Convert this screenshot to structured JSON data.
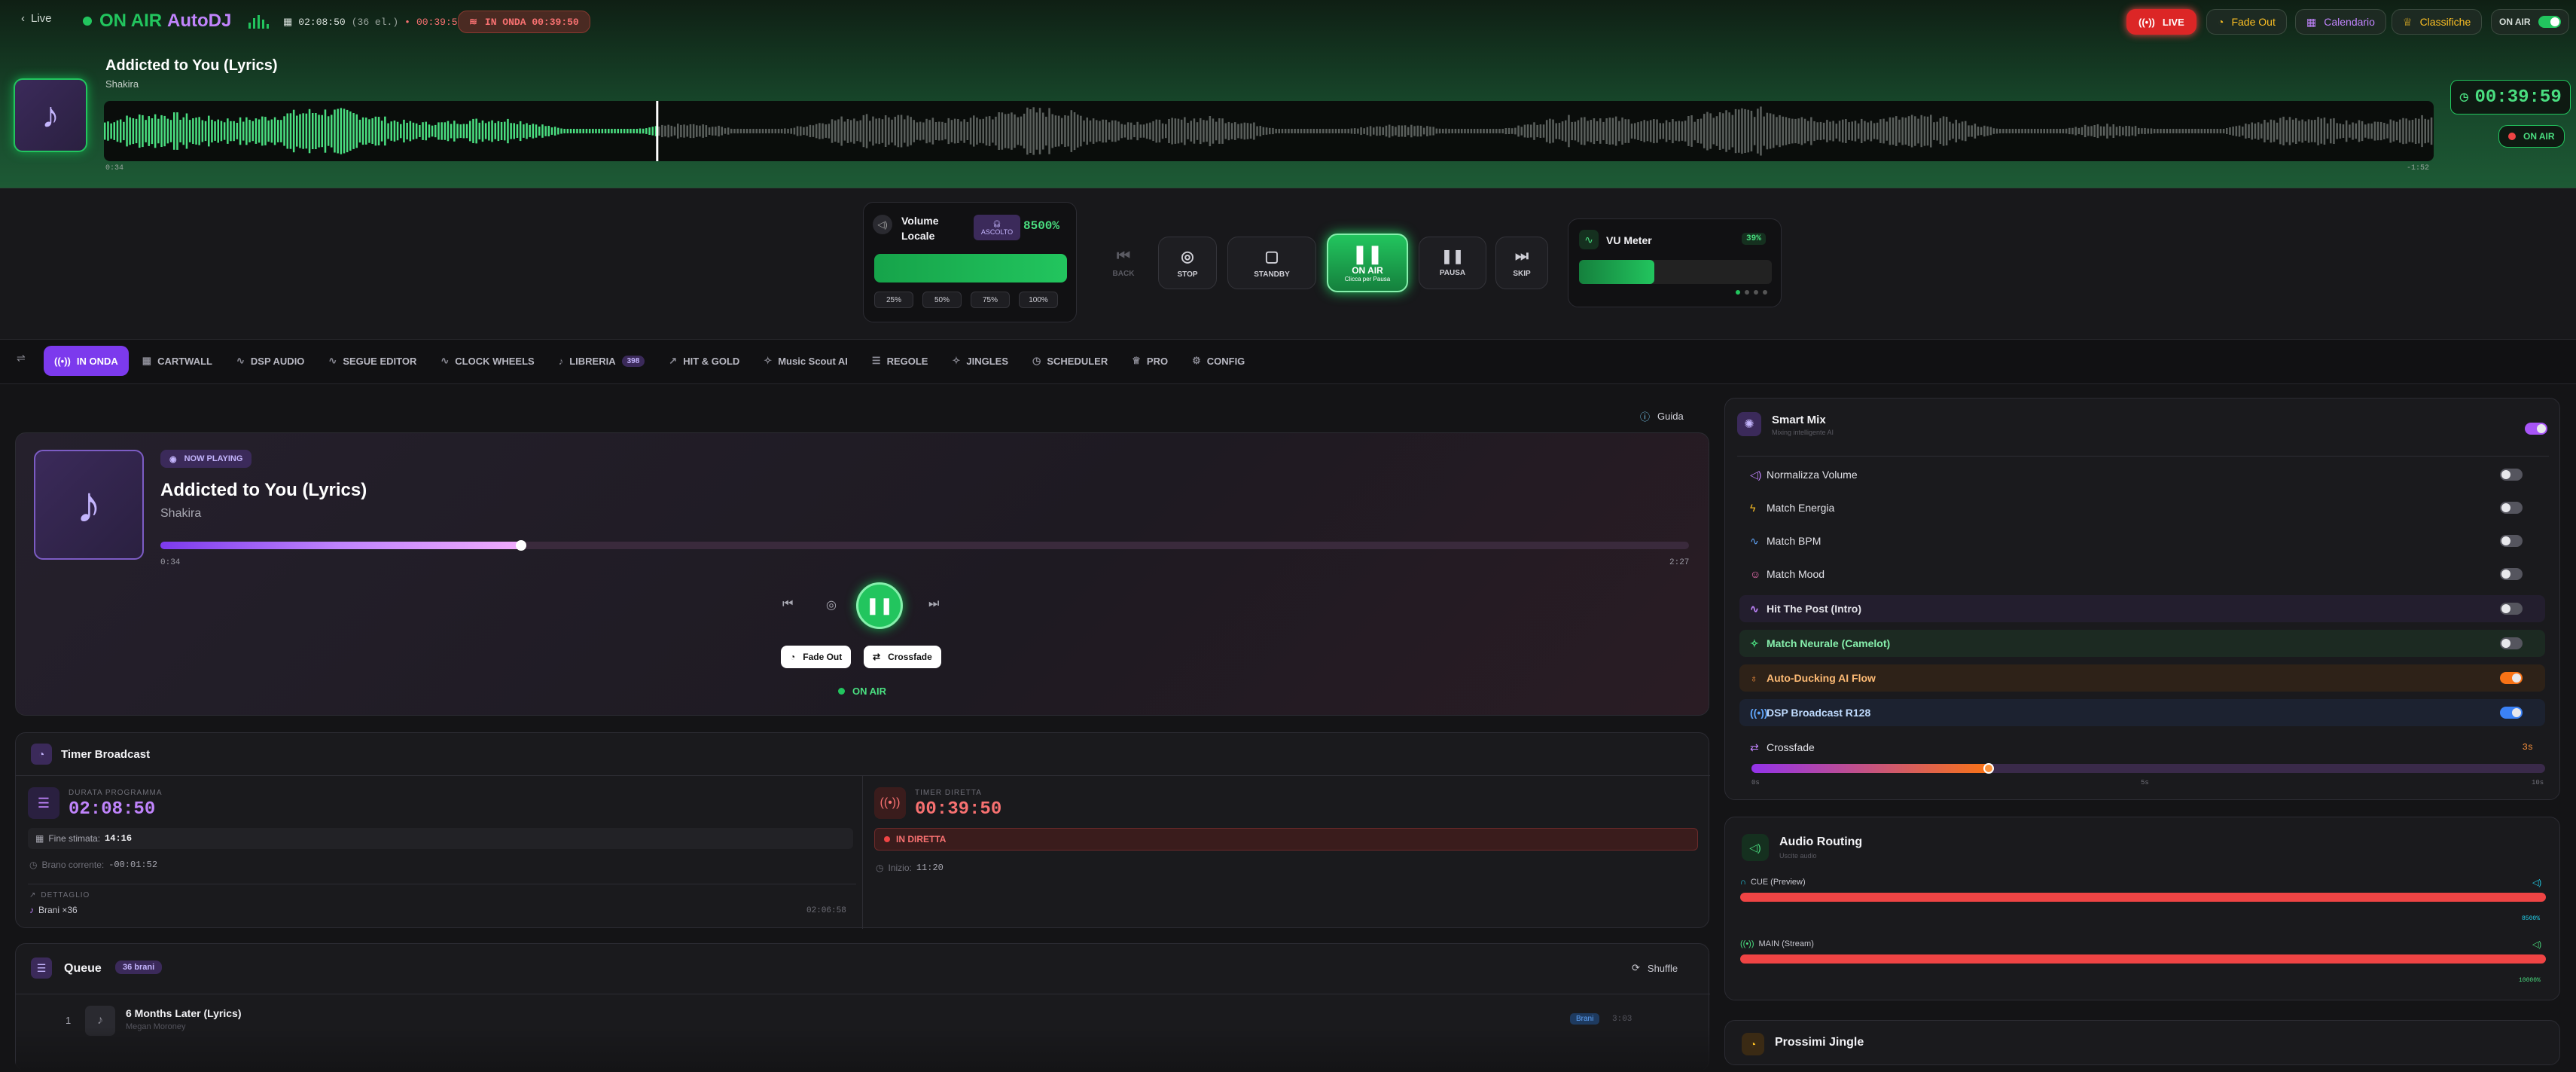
{
  "header": {
    "back_label": "Live",
    "on_air_label": "ON AIR",
    "autodj_label": "AutoDJ",
    "program_time": "02:08:50",
    "program_count": "(36 el.)",
    "live_timer": "00:39:50",
    "in_onda_badge": "IN ONDA 00:39:50",
    "live_button": "LIVE",
    "fade_out_button": "Fade Out",
    "calendar_button": "Calendario",
    "charts_button": "Classifiche",
    "on_air_toggle_label": "ON AIR"
  },
  "deck": {
    "track_title": "Addicted to You (Lyrics)",
    "artist": "Shakira",
    "elapsed": "0:34",
    "remaining": "-1:52",
    "big_clock": "00:39:59",
    "on_air_badge": "ON AIR",
    "progress_fraction": 0.237
  },
  "controls": {
    "volume_title": "Volume Locale",
    "ascolto_label": "ASCOLTO",
    "volume_percent": "8500%",
    "presets": [
      "25%",
      "50%",
      "75%",
      "100%"
    ],
    "back_label": "BACK",
    "stop_label": "STOP",
    "standby_label": "STANDBY",
    "onair_label": "ON AIR",
    "onair_sub": "Clicca per Pausa",
    "pause_label": "PAUSA",
    "skip_label": "SKIP",
    "vu_title": "VU Meter",
    "vu_level": "39%",
    "vu_fraction": 0.39
  },
  "tabs": [
    {
      "label": "IN ONDA",
      "icon": "broadcast-icon"
    },
    {
      "label": "CARTWALL",
      "icon": "grid-icon"
    },
    {
      "label": "DSP AUDIO",
      "icon": "pulse-icon"
    },
    {
      "label": "SEGUE EDITOR",
      "icon": "pulse-icon"
    },
    {
      "label": "CLOCK WHEELS",
      "icon": "pulse-icon"
    },
    {
      "label": "LIBRERIA",
      "icon": "music-icon",
      "badge": "398"
    },
    {
      "label": "HIT & GOLD",
      "icon": "trend-icon"
    },
    {
      "label": "Music Scout AI",
      "icon": "sparkle-icon"
    },
    {
      "label": "REGOLE",
      "icon": "list-icon"
    },
    {
      "label": "JINGLES",
      "icon": "sparkle-icon"
    },
    {
      "label": "SCHEDULER",
      "icon": "clock-icon"
    },
    {
      "label": "PRO",
      "icon": "crown-icon"
    },
    {
      "label": "CONFIG",
      "icon": "gear-icon"
    }
  ],
  "guide_label": "Guida",
  "now_playing": {
    "badge": "NOW PLAYING",
    "title": "Addicted to You (Lyrics)",
    "artist": "Shakira",
    "elapsed": "0:34",
    "duration": "2:27",
    "progress_fraction": 0.237,
    "fade_out": "Fade Out",
    "crossfade": "Crossfade",
    "on_air": "ON AIR"
  },
  "timer": {
    "title": "Timer Broadcast",
    "program_label": "DURATA PROGRAMMA",
    "program_value": "02:08:50",
    "end_label": "Fine stimata:",
    "end_value": "14:16",
    "current_label": "Brano corrente:",
    "current_value": "-00:01:52",
    "detail_label": "DETTAGLIO",
    "tracks_label": "Brani ×36",
    "tracks_total": "02:06:58",
    "live_label": "TIMER DIRETTA",
    "live_value": "00:39:50",
    "live_status": "IN DIRETTA",
    "start_label": "Inizio:",
    "start_value": "11:20"
  },
  "queue": {
    "title": "Queue",
    "count": "36 brani",
    "shuffle": "Shuffle",
    "items": [
      {
        "num": "1",
        "title": "6 Months Later (Lyrics)",
        "artist": "Megan Moroney",
        "tag": "Brani",
        "duration": "3:03"
      }
    ]
  },
  "smart_mix": {
    "title": "Smart Mix",
    "subtitle": "Mixing intelligente AI",
    "options": [
      {
        "label": "Normalizza Volume"
      },
      {
        "label": "Match Energia"
      },
      {
        "label": "Match BPM"
      },
      {
        "label": "Match Mood"
      },
      {
        "label": "Hit The Post (Intro)"
      },
      {
        "label": "Match Neurale (Camelot)"
      },
      {
        "label": "Auto-Ducking AI Flow"
      },
      {
        "label": "DSP Broadcast R128"
      }
    ],
    "crossfade_label": "Crossfade",
    "crossfade_value": "3s",
    "crossfade_fraction": 0.3,
    "ticks": [
      "0s",
      "5s",
      "10s"
    ]
  },
  "routing": {
    "title": "Audio Routing",
    "subtitle": "Uscite audio",
    "cue_label": "CUE (Preview)",
    "cue_value": "8500%",
    "main_label": "MAIN (Stream)",
    "main_value": "10000%"
  },
  "jingles": {
    "title": "Prossimi Jingle"
  },
  "colors": {
    "accent": "#a855f7",
    "green": "#22c55e",
    "red": "#ef4444",
    "orange": "#f97316"
  }
}
